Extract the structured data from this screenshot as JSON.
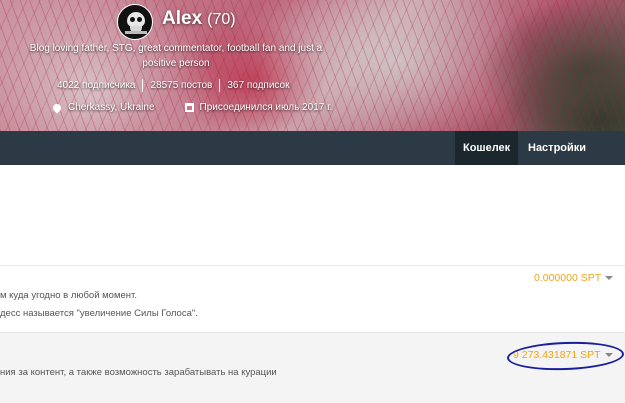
{
  "profile": {
    "name": "Alex",
    "reputation": "(70)",
    "bio": "Blog loving father, STG, great commentator, football fan and just a positive person",
    "followers": "4022 подписчика",
    "posts": "28575 постов",
    "following": "367 подписок",
    "location": "Cherkassy, Ukraine",
    "joined": "Присоединился июль 2017 г."
  },
  "nav": {
    "wallet": "Кошелек",
    "settings": "Настройки"
  },
  "wallet": {
    "row_a": {
      "line1": "м куда угодно в любой момент.",
      "line2": "десс называется \"увеличение Силы Голоса\".",
      "amount": "0.000000 SPT"
    },
    "row_b": {
      "line1": "ния за контент, а также возможность зарабатывать на курации",
      "amount": "9 273.431871 SPT"
    }
  },
  "colors": {
    "accent": "#f0a31a",
    "navbar": "#2b3a44",
    "annotation": "#1a1f9c"
  }
}
